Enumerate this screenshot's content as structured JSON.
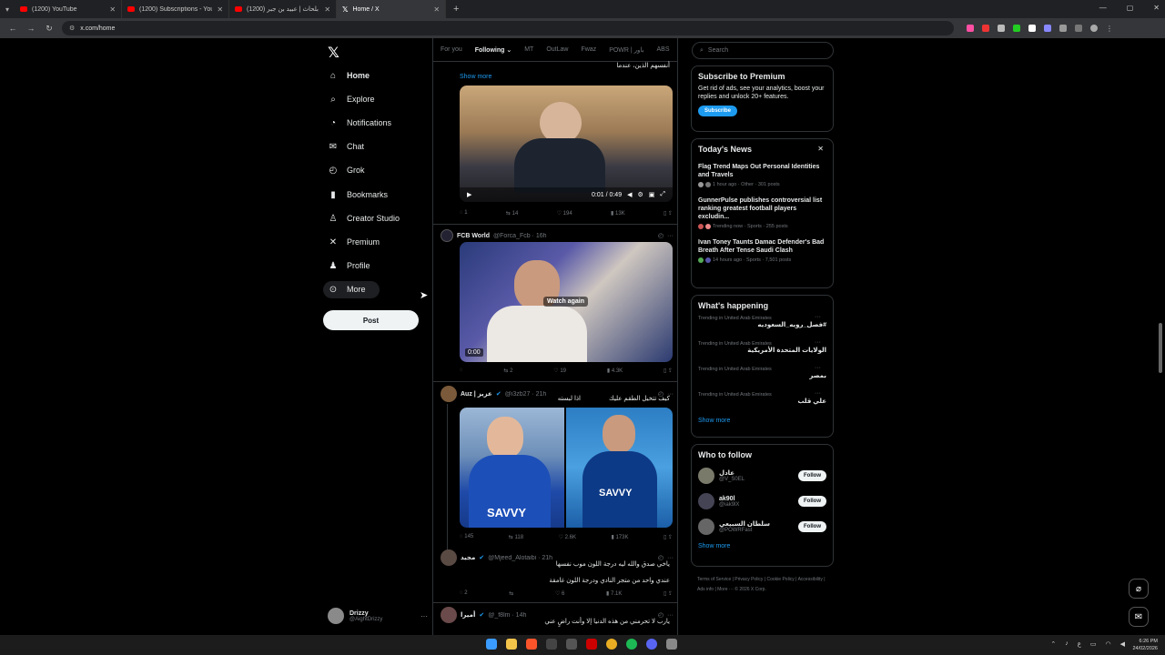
{
  "browser": {
    "tabs": [
      {
        "title": "(1200) YouTube",
        "favicon": "youtube-icon"
      },
      {
        "title": "(1200) Subscriptions - YouTube",
        "favicon": "youtube-icon"
      },
      {
        "title": "(1200) ريتو بلحاث | عبيد بن جبر",
        "favicon": "youtube-icon"
      },
      {
        "title": "Home / X",
        "favicon": "x-icon"
      }
    ],
    "url": "x.com/home"
  },
  "sidebar": {
    "items": [
      {
        "label": "Home",
        "icon": "home-icon"
      },
      {
        "label": "Explore",
        "icon": "search-icon"
      },
      {
        "label": "Notifications",
        "icon": "bell-icon"
      },
      {
        "label": "Chat",
        "icon": "mail-icon"
      },
      {
        "label": "Grok",
        "icon": "grok-icon"
      },
      {
        "label": "Bookmarks",
        "icon": "bookmark-icon"
      },
      {
        "label": "Creator Studio",
        "icon": "creator-icon"
      },
      {
        "label": "Premium",
        "icon": "x-icon"
      },
      {
        "label": "Profile",
        "icon": "person-icon"
      },
      {
        "label": "More",
        "icon": "more-circle-icon"
      }
    ],
    "post_label": "Post",
    "user": {
      "name": "Drizzy",
      "handle": "@AightDrizzy"
    }
  },
  "feed": {
    "tabs": [
      "For you",
      "Following",
      "MT",
      "OutLaw",
      "Fwaz",
      "POWR | باور",
      "ABS"
    ],
    "active_tab": "Following",
    "top_text": "أنفسهم الذين، عندما",
    "show_more": "Show more",
    "post1": {
      "video_time": "0:01 / 0:49",
      "stats": [
        "1",
        "14",
        "194",
        "13K"
      ]
    },
    "post2": {
      "name": "FCB World",
      "handle": "@Forca_Fcb · 16h",
      "watch_again": "Watch again",
      "duration": "0:00",
      "stats": [
        "",
        "2",
        "19",
        "4.3K"
      ]
    },
    "post3": {
      "name": "Auz | عزيز",
      "handle": "@i3zb27 · 21h",
      "text_right": "كيف تتخيل الطقم عليك",
      "text_left": "اذا لبسته",
      "stats": [
        "145",
        "118",
        "2.6K",
        "173K"
      ]
    },
    "post4": {
      "name": "مجيد",
      "handle": "@Mjeed_Alotaibi · 21h",
      "line1": "ياخي صدق والله ليه درجة اللون موب نفسها",
      "line2": "عندي واحد من متجر النادي ودرجة اللون غامقة",
      "stats": [
        "2",
        "",
        "6",
        "7.1K"
      ]
    },
    "post5": {
      "name": "أميرا",
      "handle": "@_f8lm · 14h",
      "text": "يارب لا تحرمني من هذه الدنيا إلا وأنت راضٍ عني"
    }
  },
  "right": {
    "search_placeholder": "Search",
    "premium": {
      "title": "Subscribe to Premium",
      "text": "Get rid of ads, see your analytics, boost your replies and unlock 20+ features.",
      "button": "Subscribe"
    },
    "news": {
      "title": "Today's News",
      "items": [
        {
          "title": "Flag Trend Maps Out Personal Identities and Travels",
          "meta": "1 hour ago · Other · 301 posts"
        },
        {
          "title": "GunnerPulse publishes controversial list ranking greatest football players excludin...",
          "meta": "Trending now · Sports · 255 posts"
        },
        {
          "title": "Ivan Toney Taunts Damac Defender's Bad Breath After Tense Saudi Clash",
          "meta": "14 hours ago · Sports · 7,501 posts"
        }
      ]
    },
    "happening": {
      "title": "What's happening",
      "items": [
        {
          "context": "Trending in United Arab Emirates",
          "value": "#فصل_رويه_السعوديه"
        },
        {
          "context": "Trending in United Arab Emirates",
          "value": "الولايات المتحدة الأمريكية"
        },
        {
          "context": "Trending in United Arab Emirates",
          "value": "بمصر"
        },
        {
          "context": "Trending in United Arab Emirates",
          "value": "علي قلب"
        }
      ],
      "show_more": "Show more"
    },
    "who_to_follow": {
      "title": "Who to follow",
      "items": [
        {
          "name": "عادل",
          "handle": "@V_S0EL",
          "button": "Follow"
        },
        {
          "name": "ak90l",
          "handle": "@iak9lX",
          "button": "Follow"
        },
        {
          "name": "سلطان السبيعي",
          "handle": "@POWRFast",
          "button": "Follow"
        }
      ],
      "show_more": "Show more"
    },
    "footer": "Terms of Service | Privacy Policy | Cookie Policy | Accessibility | Ads info | More ··· © 2026 X Corp."
  },
  "taskbar": {
    "lang": "ع",
    "time": "6:26 PM",
    "date": "24/02/2026"
  }
}
